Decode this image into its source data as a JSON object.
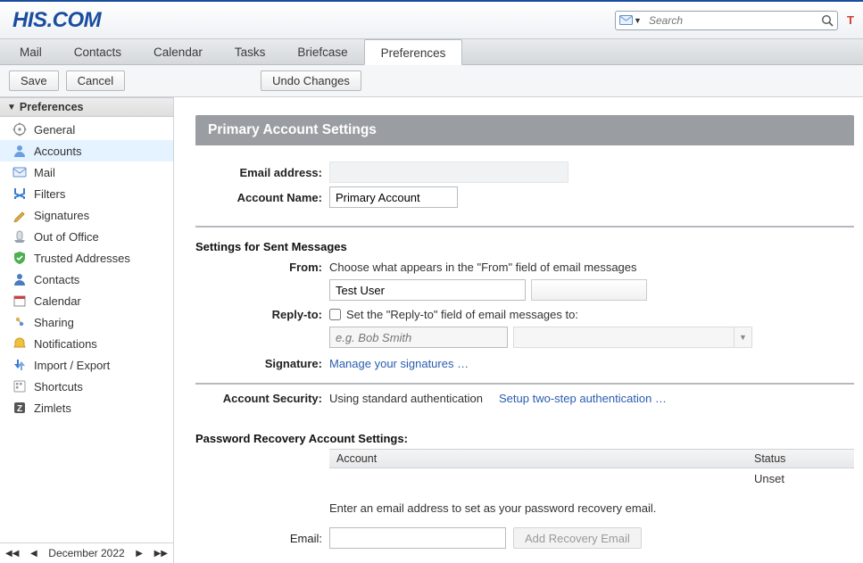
{
  "logo_text": "HIS.COM",
  "search": {
    "placeholder": "Search"
  },
  "tabs": [
    "Mail",
    "Contacts",
    "Calendar",
    "Tasks",
    "Briefcase",
    "Preferences"
  ],
  "active_tab_index": 5,
  "toolbar": {
    "save": "Save",
    "cancel": "Cancel",
    "undo": "Undo Changes"
  },
  "sidebar": {
    "header": "Preferences",
    "items": [
      "General",
      "Accounts",
      "Mail",
      "Filters",
      "Signatures",
      "Out of Office",
      "Trusted Addresses",
      "Contacts",
      "Calendar",
      "Sharing",
      "Notifications",
      "Import / Export",
      "Shortcuts",
      "Zimlets"
    ],
    "selected_index": 1
  },
  "calnav": {
    "label": "December 2022"
  },
  "panel": {
    "title": "Primary Account Settings",
    "email_lbl": "Email address:",
    "acct_name_lbl": "Account Name:",
    "acct_name_val": "Primary Account",
    "sent_header": "Settings for Sent Messages",
    "from_lbl": "From:",
    "from_hint": "Choose what appears in the \"From\" field of email messages",
    "from_name_val": "Test User",
    "replyto_lbl": "Reply-to:",
    "replyto_chk": "Set the \"Reply-to\" field of email messages to:",
    "replyto_ph": "e.g. Bob Smith",
    "sig_lbl": "Signature:",
    "sig_link": "Manage your signatures …",
    "sec_lbl": "Account Security:",
    "sec_text": "Using standard authentication",
    "sec_link": "Setup two-step authentication …",
    "recov_header": "Password Recovery Account Settings:",
    "tbl_acct": "Account",
    "tbl_status": "Status",
    "tbl_status_val": "Unset",
    "recov_hint": "Enter an email address to set as your password recovery email.",
    "email_field_lbl": "Email:",
    "add_recov_btn": "Add Recovery Email"
  }
}
